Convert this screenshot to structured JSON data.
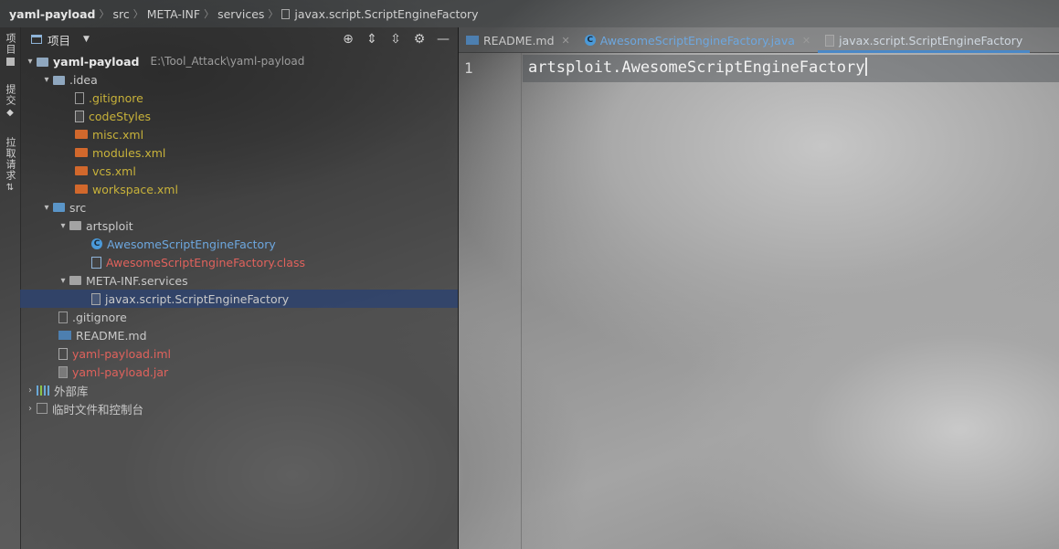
{
  "navbar": {
    "crumbs": [
      "yaml-payload",
      "src",
      "META-INF",
      "services",
      "javax.script.ScriptEngineFactory"
    ]
  },
  "stripe": {
    "project_label": "项目",
    "commit_label": "提交",
    "pull_requests_label": "拉取请求"
  },
  "project_panel": {
    "title": "项目",
    "tree": [
      {
        "label": "yaml-payload",
        "path": "E:\\Tool_Attack\\yaml-payload"
      },
      {
        "label": ".idea"
      },
      {
        "label": ".gitignore"
      },
      {
        "label": "codeStyles"
      },
      {
        "label": "misc.xml"
      },
      {
        "label": "modules.xml"
      },
      {
        "label": "vcs.xml"
      },
      {
        "label": "workspace.xml"
      },
      {
        "label": "src"
      },
      {
        "label": "artsploit"
      },
      {
        "label": "AwesomeScriptEngineFactory"
      },
      {
        "label": "AwesomeScriptEngineFactory.class"
      },
      {
        "label": "META-INF.services"
      },
      {
        "label": "javax.script.ScriptEngineFactory"
      },
      {
        "label": ".gitignore"
      },
      {
        "label": "README.md"
      },
      {
        "label": "yaml-payload.iml"
      },
      {
        "label": "yaml-payload.jar"
      },
      {
        "label": "外部库"
      },
      {
        "label": "临时文件和控制台"
      }
    ]
  },
  "editor": {
    "tabs": [
      {
        "label": "README.md"
      },
      {
        "label": "AwesomeScriptEngineFactory.java"
      },
      {
        "label": "javax.script.ScriptEngineFactory"
      }
    ],
    "line_number": "1",
    "code_line": "artsploit.AwesomeScriptEngineFactory"
  }
}
